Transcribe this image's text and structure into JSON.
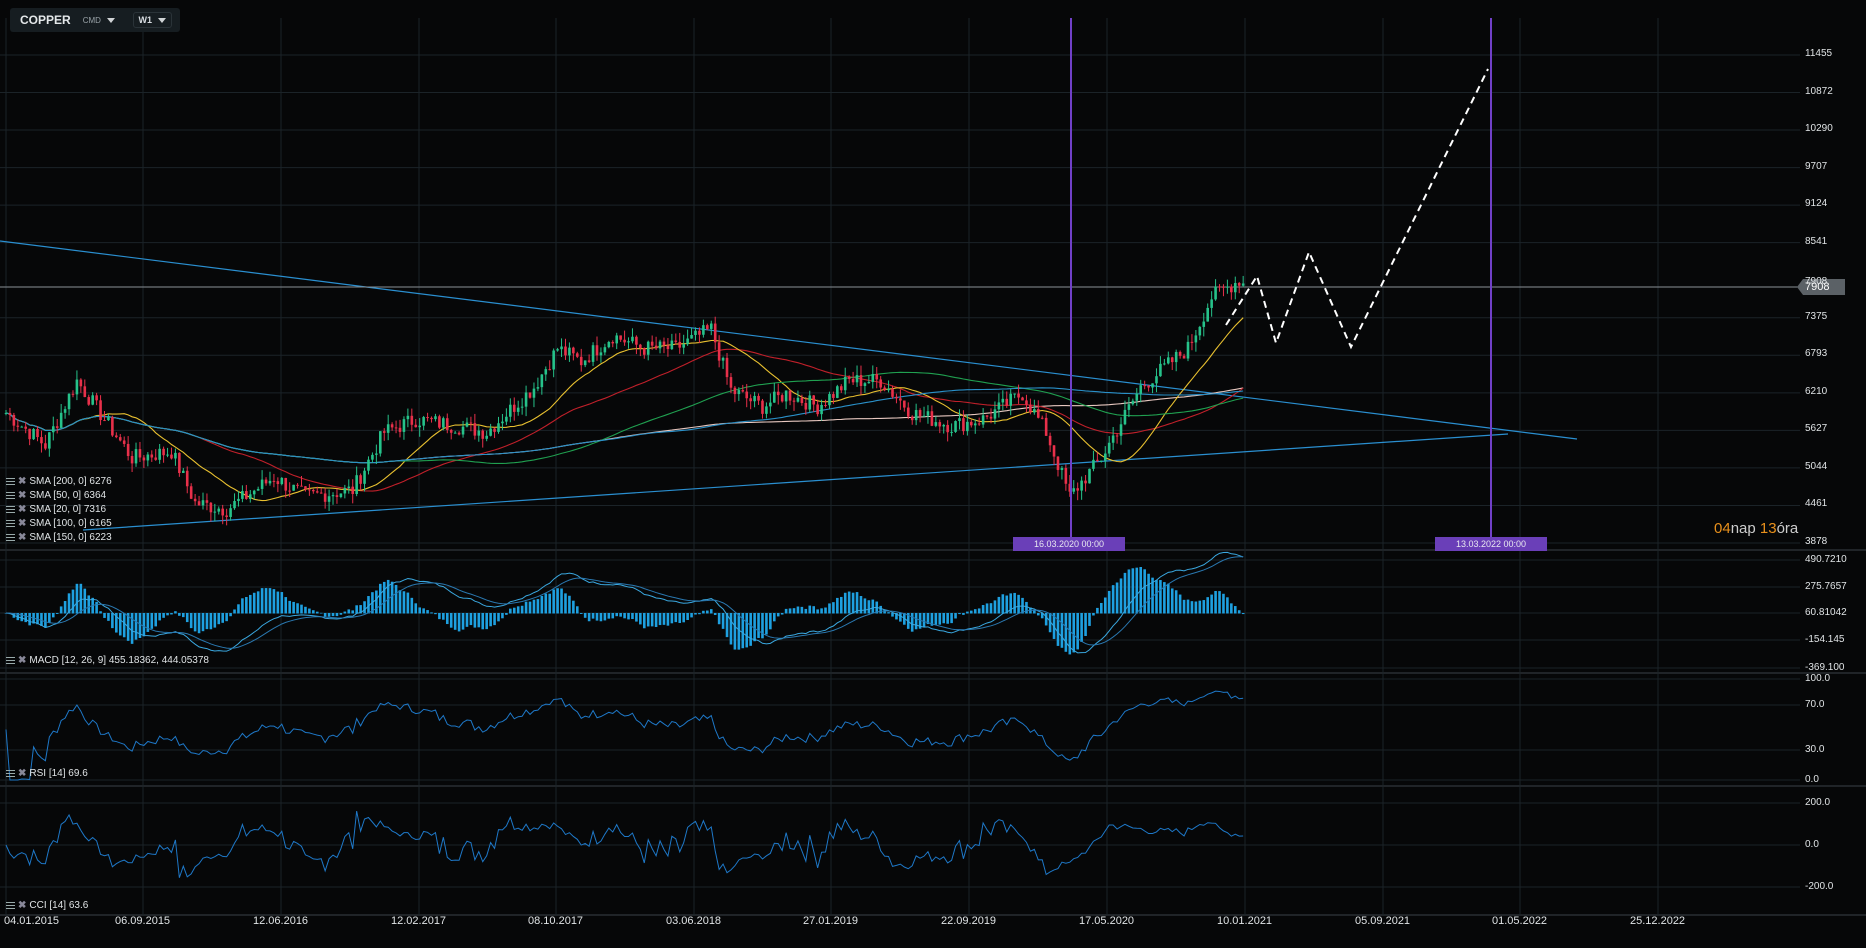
{
  "toolbar": {
    "symbol": "COPPER",
    "market": "CMD",
    "timeframe": "W1"
  },
  "countdown": {
    "days": "04",
    "days_unit": "nap",
    "hours": "13",
    "hours_unit": "óra"
  },
  "current_price": "7908",
  "vertical_markers": [
    "16.03.2020 00:00",
    "13.03.2022 00:00"
  ],
  "indicators": {
    "sma": [
      {
        "label": "SMA [200, 0] 6276",
        "period": 200,
        "color": "#e8c8c0"
      },
      {
        "label": "SMA [50, 0] 6364",
        "period": 50,
        "color": "#c0202a"
      },
      {
        "label": "SMA [20, 0] 7316",
        "period": 20,
        "color": "#e8c030"
      },
      {
        "label": "SMA [100, 0] 6165",
        "period": 100,
        "color": "#20a050"
      },
      {
        "label": "SMA [150, 0] 6223",
        "period": 150,
        "color": "#2a90c8"
      }
    ],
    "macd": "MACD [12, 26, 9] 455.18362,   444.05378",
    "rsi": "RSI [14] 69.6",
    "cci": "CCI [14] 63.6"
  },
  "chart_data": {
    "type": "candlestick",
    "title": "COPPER W1",
    "price_ticks": [
      "11455",
      "10872",
      "10290",
      "9707",
      "9124",
      "8541",
      "7908",
      "7375",
      "6793",
      "6210",
      "5627",
      "5044",
      "4461",
      "3878"
    ],
    "macd_ticks": [
      "490.7210",
      "275.7657",
      "60.81042",
      "-154.145",
      "-369.100"
    ],
    "rsi_ticks": [
      "100.0",
      "70.0",
      "30.0",
      "0.0"
    ],
    "cci_ticks": [
      "200.0",
      "0.0",
      "-200.0"
    ],
    "x_ticks": [
      "04.01.2015",
      "06.09.2015",
      "12.06.2016",
      "12.02.2017",
      "08.10.2017",
      "03.06.2018",
      "27.01.2019",
      "22.09.2019",
      "17.05.2020",
      "10.01.2021",
      "05.09.2021",
      "01.05.2022",
      "25.12.2022"
    ],
    "price_keypoints_week_close": [
      [
        0,
        5900
      ],
      [
        10,
        5400
      ],
      [
        18,
        6400
      ],
      [
        32,
        5200
      ],
      [
        42,
        5300
      ],
      [
        48,
        4500
      ],
      [
        56,
        4400
      ],
      [
        68,
        4900
      ],
      [
        76,
        4600
      ],
      [
        88,
        4700
      ],
      [
        96,
        5600
      ],
      [
        104,
        5800
      ],
      [
        114,
        5700
      ],
      [
        122,
        5600
      ],
      [
        134,
        6300
      ],
      [
        140,
        6900
      ],
      [
        146,
        6700
      ],
      [
        154,
        7100
      ],
      [
        162,
        6900
      ],
      [
        170,
        6900
      ],
      [
        179,
        7200
      ],
      [
        184,
        6250
      ],
      [
        192,
        6000
      ],
      [
        198,
        6200
      ],
      [
        206,
        6000
      ],
      [
        214,
        6400
      ],
      [
        222,
        6400
      ],
      [
        230,
        5900
      ],
      [
        240,
        5700
      ],
      [
        248,
        5800
      ],
      [
        258,
        6200
      ],
      [
        264,
        5600
      ],
      [
        270,
        4600
      ],
      [
        278,
        5200
      ],
      [
        288,
        6300
      ],
      [
        296,
        6700
      ],
      [
        300,
        6900
      ],
      [
        306,
        7700
      ],
      [
        314,
        8000
      ]
    ],
    "projection_path": [
      [
        7500
      ],
      [
        8100
      ],
      [
        7100
      ],
      [
        8450
      ],
      [
        6950
      ],
      [
        11300
      ]
    ],
    "trendlines": [
      "descending resistance from ~8600 (2015) to ~5600",
      "ascending support from ~4300 (2015) to ~5650 (2022)"
    ]
  }
}
